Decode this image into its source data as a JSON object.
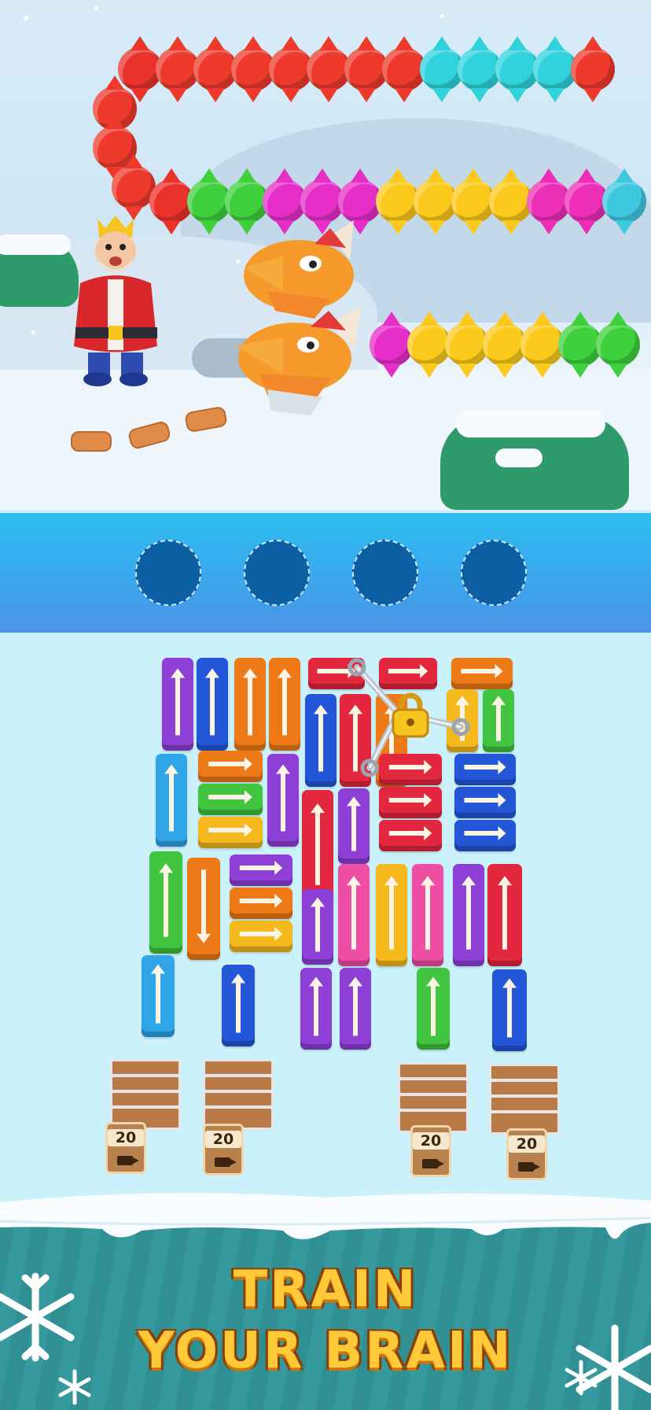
{
  "scene": {
    "king": "king-character",
    "dragon": "dragon-heads"
  },
  "slots": [
    {
      "name": "slot-1"
    },
    {
      "name": "slot-2"
    },
    {
      "name": "slot-3"
    },
    {
      "name": "slot-4"
    }
  ],
  "trays": [
    {
      "count": "20"
    },
    {
      "count": "20"
    },
    {
      "count": "20"
    },
    {
      "count": "20"
    }
  ],
  "banner": {
    "line1": "TRAIN",
    "line2": "YOUR BRAIN"
  },
  "colors": {
    "purple": "#8d3fd6",
    "blue": "#2457d8",
    "orange": "#ee7a17",
    "red": "#e2273e",
    "green": "#41c43f",
    "yellow": "#f5b91d",
    "pink": "#ee4ea4",
    "cyan": "#2fa6e8",
    "banner_text": "#ffc93a",
    "water": "#2f8f93"
  },
  "icons": [
    "up-arrow-icon",
    "right-arrow-icon",
    "lock-icon",
    "chain-icon",
    "camera-icon",
    "snowflake-icon"
  ]
}
